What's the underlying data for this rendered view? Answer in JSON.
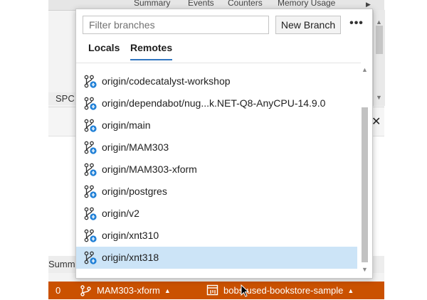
{
  "background": {
    "tabs": [
      "Summary",
      "Events",
      "Counters",
      "Memory Usage"
    ],
    "spc_label": "SPC",
    "summary_label": "Summar"
  },
  "popup": {
    "filter_placeholder": "Filter branches",
    "new_branch_label": "New Branch",
    "more_label": "•••",
    "tabs": [
      {
        "label": "Locals",
        "active": false
      },
      {
        "label": "Remotes",
        "active": true
      }
    ],
    "branches": [
      {
        "label": "origin/codecatalyst-workshop"
      },
      {
        "label": "origin/dependabot/nug...k.NET-Q8-AnyCPU-14.9.0"
      },
      {
        "label": "origin/main"
      },
      {
        "label": "origin/MAM303"
      },
      {
        "label": "origin/MAM303-xform"
      },
      {
        "label": "origin/postgres"
      },
      {
        "label": "origin/v2"
      },
      {
        "label": "origin/xnt310"
      },
      {
        "label": "origin/xnt318",
        "selected": true
      }
    ]
  },
  "statusbar": {
    "count": "0",
    "branch": "MAM303-xform",
    "repo": "bobs-used-bookstore-sample"
  },
  "colors": {
    "statusbar": "#ca5100",
    "selected_row": "#cce4f7",
    "accent": "#2f74c0",
    "branch_icon_badge": "#1f7fd6"
  }
}
